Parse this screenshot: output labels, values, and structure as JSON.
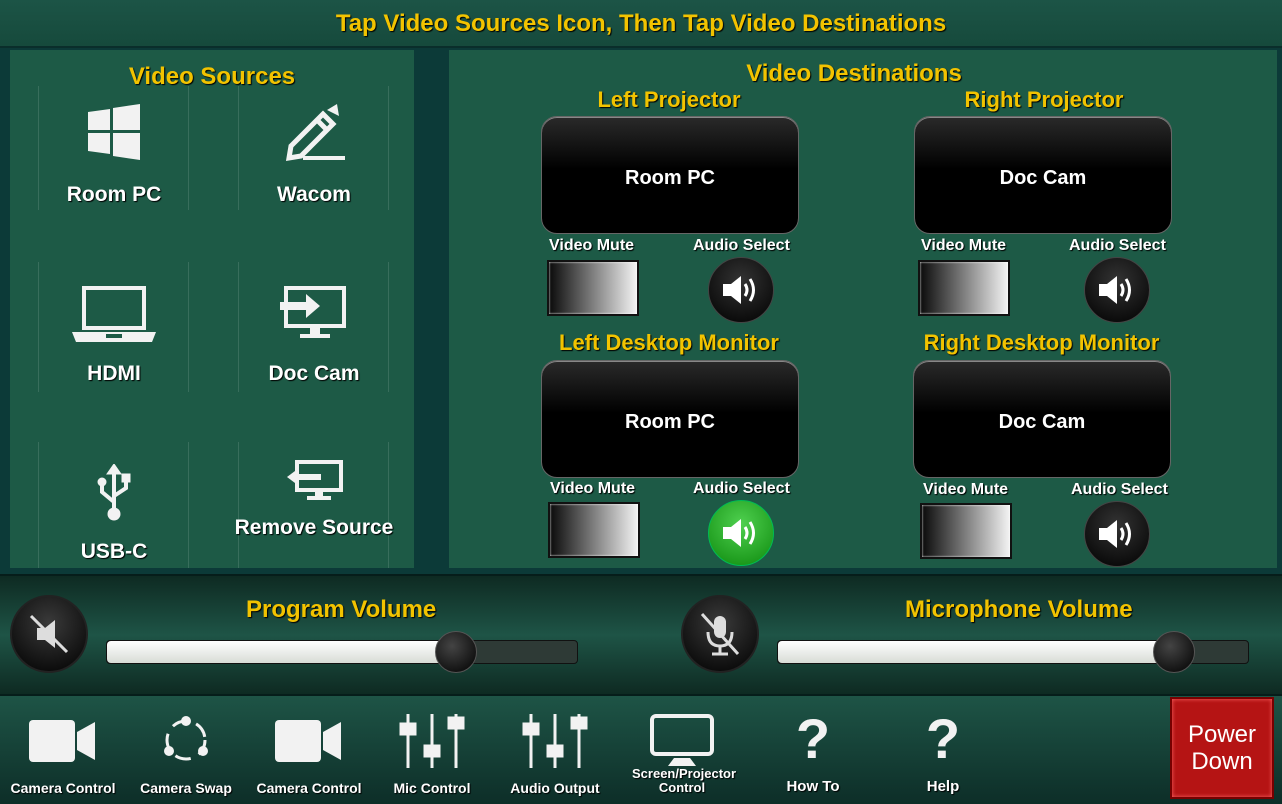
{
  "header": {
    "title": "Tap Video Sources Icon, Then Tap Video Destinations"
  },
  "sources": {
    "title": "Video Sources",
    "items": [
      {
        "label": "Room PC",
        "icon": "windows-icon"
      },
      {
        "label": "Wacom",
        "icon": "pen-tablet-icon"
      },
      {
        "label": "HDMI",
        "icon": "laptop-icon"
      },
      {
        "label": "Doc Cam",
        "icon": "monitor-input-icon"
      },
      {
        "label": "USB-C",
        "icon": "usb-icon"
      },
      {
        "label": "Remove Source",
        "icon": "monitor-remove-icon"
      }
    ]
  },
  "destinations": {
    "title": "Video Destinations",
    "mute_label": "Video Mute",
    "audio_label": "Audio Select",
    "items": [
      {
        "name": "Left Projector",
        "source": "Room PC",
        "audio_selected": false
      },
      {
        "name": "Right Projector",
        "source": "Doc Cam",
        "audio_selected": false
      },
      {
        "name": "Left Desktop Monitor",
        "source": "Room PC",
        "audio_selected": true
      },
      {
        "name": "Right Desktop Monitor",
        "source": "Doc Cam",
        "audio_selected": false
      }
    ]
  },
  "volume": {
    "program": {
      "title": "Program Volume",
      "level_percent": 74
    },
    "microphone": {
      "title": "Microphone Volume",
      "level_percent": 84
    }
  },
  "bottom_bar": {
    "items": [
      {
        "label": "Camera Control",
        "icon": "video-camera-icon"
      },
      {
        "label": "Camera Swap",
        "icon": "rotate-circle-icon"
      },
      {
        "label": "Camera Control",
        "icon": "video-camera-icon"
      },
      {
        "label": "Mic Control",
        "icon": "mixer-sliders-icon"
      },
      {
        "label": "Audio Output",
        "icon": "mixer-sliders-icon"
      },
      {
        "label": "Screen/Projector Control",
        "icon": "monitor-icon"
      },
      {
        "label": "How To",
        "icon": "question-icon"
      },
      {
        "label": "Help",
        "icon": "question-icon"
      }
    ],
    "power": {
      "line1": "Power",
      "line2": "Down"
    }
  },
  "colors": {
    "accent_text": "#f2c300",
    "panel": "#1d5a46",
    "power": "#b51414",
    "audio_active": "#1ea21e"
  }
}
